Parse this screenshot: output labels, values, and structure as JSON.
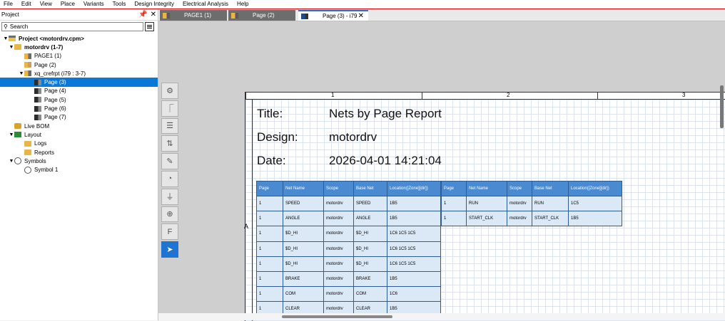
{
  "menu": [
    "File",
    "Edit",
    "View",
    "Place",
    "Variants",
    "Tools",
    "Design Integrity",
    "Electrical Analysis",
    "Help"
  ],
  "panel": {
    "title": "Project",
    "pin_icon": "pin-icon",
    "close_icon": "close-icon",
    "search_placeholder": "Search"
  },
  "tree": [
    {
      "label": "Project <motordrv.cpm>",
      "level": 0,
      "twisty": "▼",
      "icon": "proj",
      "bold": true
    },
    {
      "label": "motordrv (1-7)",
      "level": 1,
      "twisty": "▼",
      "icon": "folder",
      "bold": true
    },
    {
      "label": "PAGE1 (1)",
      "level": 2,
      "twisty": "",
      "icon": "pagefold"
    },
    {
      "label": "Page (2)",
      "level": 2,
      "twisty": "",
      "icon": "pagelight"
    },
    {
      "label": "xq_crefrpt (i79 : 3-7)",
      "level": 2,
      "twisty": "▼",
      "icon": "pagefold"
    },
    {
      "label": "Page (3)",
      "level": 3,
      "twisty": "",
      "icon": "pagedark",
      "selected": true
    },
    {
      "label": "Page (4)",
      "level": 3,
      "twisty": "",
      "icon": "pagedark"
    },
    {
      "label": "Page (5)",
      "level": 3,
      "twisty": "",
      "icon": "pagedark"
    },
    {
      "label": "Page (6)",
      "level": 3,
      "twisty": "",
      "icon": "pagedark"
    },
    {
      "label": "Page (7)",
      "level": 3,
      "twisty": "",
      "icon": "pagedark"
    },
    {
      "label": "Live BOM",
      "level": 1,
      "twisty": "",
      "icon": "bom"
    },
    {
      "label": "Layout",
      "level": 1,
      "twisty": "▼",
      "icon": "layout"
    },
    {
      "label": "Logs",
      "level": 2,
      "twisty": "",
      "icon": "folder"
    },
    {
      "label": "Reports",
      "level": 2,
      "twisty": "",
      "icon": "folder"
    },
    {
      "label": "Symbols",
      "level": 1,
      "twisty": "▼",
      "icon": "sym"
    },
    {
      "label": "Symbol 1",
      "level": 2,
      "twisty": "",
      "icon": "sym"
    }
  ],
  "tabs": [
    {
      "label": "PAGE1 (1)",
      "icon": "o",
      "active": false
    },
    {
      "label": "Page (2)",
      "icon": "o",
      "active": false
    },
    {
      "label": "Page (3) - i79",
      "icon": "d",
      "active": true,
      "close": "✕"
    }
  ],
  "tools": [
    {
      "name": "component-icon",
      "glyph": "⚙",
      "more": false
    },
    {
      "name": "wire-icon",
      "glyph": "⎾",
      "more": false
    },
    {
      "name": "bus-icon",
      "glyph": "☰",
      "more": false
    },
    {
      "name": "net-group-icon",
      "glyph": "⇅",
      "more": false
    },
    {
      "name": "text-note-icon",
      "glyph": "✎",
      "more": true
    },
    {
      "name": "shapes-icon",
      "glyph": "◔",
      "more": true
    },
    {
      "name": "ground-icon",
      "glyph": "⏚",
      "more": true
    },
    {
      "name": "zoom-icon",
      "glyph": "⊕",
      "more": true
    },
    {
      "name": "find-icon",
      "glyph": "F",
      "more": true
    },
    {
      "name": "select-arrow-icon",
      "glyph": "➤",
      "more": false,
      "active": true
    }
  ],
  "sheet": {
    "zones": [
      "1",
      "2",
      "3"
    ],
    "row_letter": "A",
    "title_label": "Title:",
    "title_value": "Nets by Page Report",
    "design_label": "Design:",
    "design_value": "motordrv",
    "date_label": "Date:",
    "date_value": "2026-04-01 14:21:04"
  },
  "table1": {
    "headers": [
      "Page",
      "Net Name",
      "Scope",
      "Base Net",
      "Location([Zone][dir])"
    ],
    "rows": [
      [
        "1",
        "SPEED",
        "motordrv",
        "SPEED",
        "1B5"
      ],
      [
        "1",
        "ANGLE",
        "motordrv",
        "ANGLE",
        "1B5"
      ],
      [
        "1",
        "$D_HI",
        "motordrv",
        "$D_HI",
        "1C6 1C5 1C5"
      ],
      [
        "1",
        "$D_HI",
        "motordrv",
        "$D_HI",
        "1C6 1C5 1C5"
      ],
      [
        "1",
        "$D_HI",
        "motordrv",
        "$D_HI",
        "1C6 1C5 1C5"
      ],
      [
        "1",
        "BRAKE",
        "motordrv",
        "BRAKE",
        "1B5"
      ],
      [
        "1",
        "COM",
        "motordrv",
        "COM",
        "1C6"
      ],
      [
        "1",
        "CLEAR",
        "motordrv",
        "CLEAR",
        "1B5"
      ]
    ]
  },
  "table2": {
    "headers": [
      "Page",
      "Net Name",
      "Scope",
      "Base Net",
      "Location([Zone][dir])"
    ],
    "rows": [
      [
        "1",
        "RUN",
        "motordrv",
        "RUN",
        "1C5"
      ],
      [
        "1",
        "START_CLK",
        "motordrv",
        "START_CLK",
        "1B5"
      ]
    ]
  },
  "colors": {
    "accent": "#0a78d7",
    "table_header": "#4a8ad0",
    "table_cell": "#dbe9f7"
  }
}
